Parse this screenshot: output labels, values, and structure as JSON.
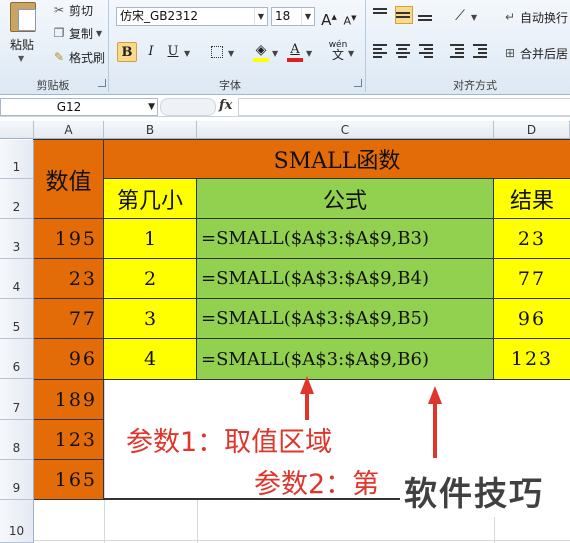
{
  "ribbon": {
    "clipboard": {
      "paste": "粘贴",
      "cut": "剪切",
      "copy": "复制",
      "format_painter": "格式刷",
      "group_label": "剪贴板"
    },
    "font": {
      "font_name": "仿宋_GB2312",
      "font_size": "18",
      "grow": "A",
      "shrink": "A",
      "bold": "B",
      "italic": "I",
      "underline": "U",
      "phonetic": "wén",
      "group_label": "字体"
    },
    "alignment": {
      "wrap_text": "自动换行",
      "merge_center": "合并后居",
      "group_label": "对齐方式"
    }
  },
  "formula_bar": {
    "name_box": "G12",
    "fx": "fx",
    "content": ""
  },
  "columns": [
    "A",
    "B",
    "C",
    "D"
  ],
  "rows": [
    "1",
    "2",
    "3",
    "4",
    "5",
    "6",
    "7",
    "8",
    "9",
    "10"
  ],
  "table": {
    "header_value": "数值",
    "title": "SMALL函数",
    "col_k": "第几小",
    "col_formula": "公式",
    "col_result": "结果",
    "values": [
      "195",
      "23",
      "77",
      "96",
      "189",
      "123",
      "165"
    ],
    "k": [
      "1",
      "2",
      "3",
      "4"
    ],
    "formulas": [
      "=SMALL($A$3:$A$9,B3)",
      "=SMALL($A$3:$A$9,B4)",
      "=SMALL($A$3:$A$9,B5)",
      "=SMALL($A$3:$A$9,B6)"
    ],
    "results": [
      "23",
      "77",
      "96",
      "123"
    ]
  },
  "annotations": {
    "param1": "参数1：取值区域",
    "param2": "参数2：第"
  },
  "watermark": "软件技巧",
  "colors": {
    "orange": "#e36c09",
    "yellow": "#ffff00",
    "green": "#92d050",
    "annotation_red": "#e0352a"
  }
}
